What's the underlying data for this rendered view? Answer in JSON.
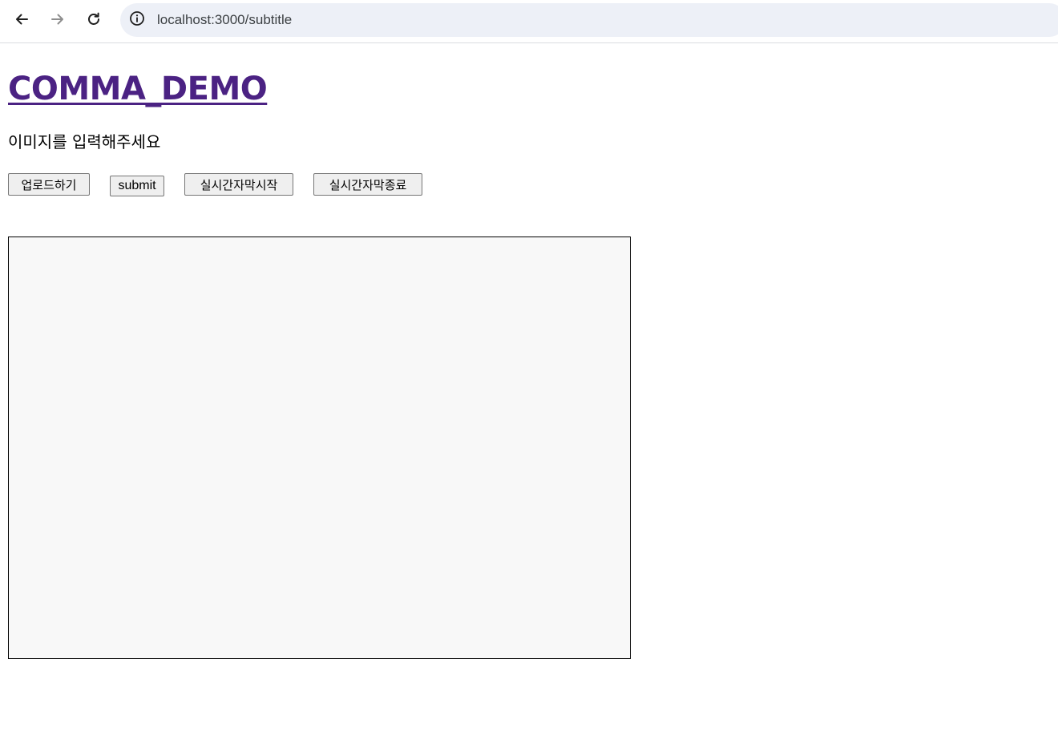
{
  "browser": {
    "url": "localhost:3000/subtitle",
    "icons": {
      "back": "arrow-left-icon",
      "forward": "arrow-right-icon",
      "reload": "reload-icon",
      "site_info": "info-icon"
    }
  },
  "page": {
    "title": "COMMA_DEMO",
    "prompt": "이미지를 입력해주세요",
    "buttons": {
      "upload": "업로드하기",
      "submit": "submit",
      "live_start": "실시간자막시작",
      "live_stop": "실시간자막종료"
    }
  },
  "colors": {
    "title_link": "#4b2283",
    "omnibox_bg": "#edf0f7",
    "canvas_bg": "#f8f8f8"
  }
}
